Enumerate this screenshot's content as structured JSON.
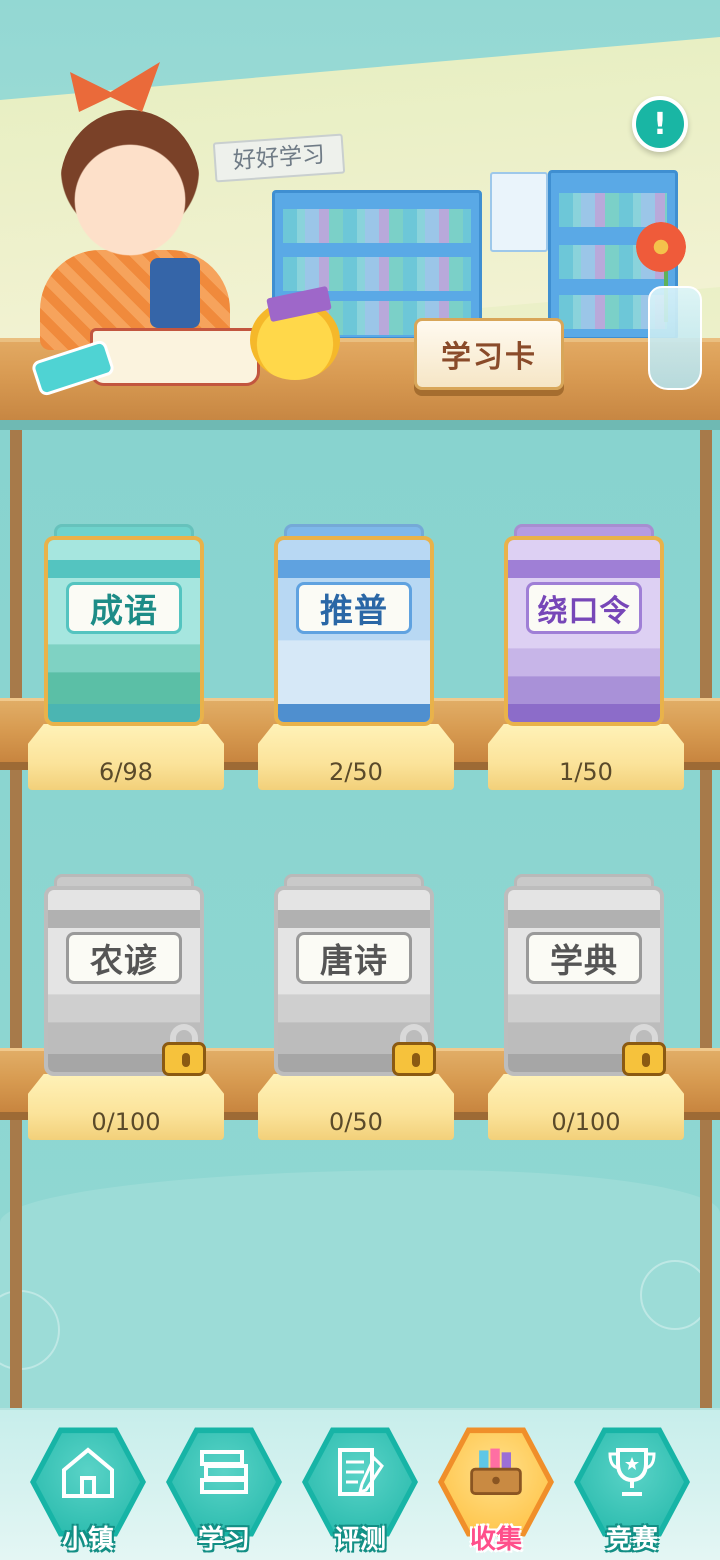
{
  "header": {
    "slogan": "好好学习",
    "card_stand_label": "学习卡",
    "info_button_glyph": "!"
  },
  "collections": [
    {
      "key": "chengyu",
      "title": "成语",
      "progress": "6/98",
      "theme": "teal",
      "locked": false
    },
    {
      "key": "tuipu",
      "title": "推普",
      "progress": "2/50",
      "theme": "blue",
      "locked": false
    },
    {
      "key": "raokouling",
      "title": "绕口令",
      "progress": "1/50",
      "theme": "purple",
      "locked": false
    },
    {
      "key": "nongyan",
      "title": "农谚",
      "progress": "0/100",
      "theme": "gray",
      "locked": true
    },
    {
      "key": "tangshi",
      "title": "唐诗",
      "progress": "0/50",
      "theme": "gray",
      "locked": true
    },
    {
      "key": "xuedian",
      "title": "学典",
      "progress": "0/100",
      "theme": "gray",
      "locked": true
    }
  ],
  "nav": {
    "items": [
      {
        "label": "小镇",
        "icon": "house-icon",
        "active": false
      },
      {
        "label": "学习",
        "icon": "books-stack-icon",
        "active": false
      },
      {
        "label": "评测",
        "icon": "checklist-pencil-icon",
        "active": false
      },
      {
        "label": "收集",
        "icon": "treasure-box-icon",
        "active": true
      },
      {
        "label": "竞赛",
        "icon": "trophy-icon",
        "active": false
      }
    ]
  },
  "colors": {
    "background": "#8fd6d2",
    "accent_teal": "#17b4a6",
    "active_tab": "#ff4f8b",
    "locked_gray": "#bdbdbd"
  }
}
